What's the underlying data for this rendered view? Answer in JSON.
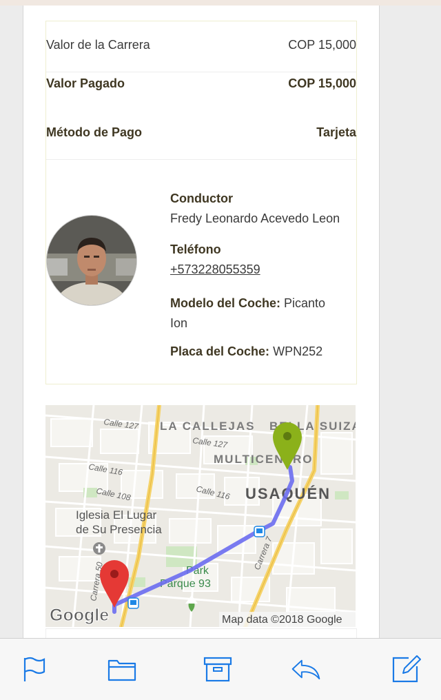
{
  "receipt": {
    "fare_label": "Valor de la Carrera",
    "fare_value": "COP 15,000",
    "paid_label": "Valor Pagado",
    "paid_value": "COP 15,000",
    "method_label": "Método de Pago",
    "method_value": "Tarjeta"
  },
  "driver": {
    "avatar_icon": "driver-avatar",
    "driver_label": "Conductor",
    "driver_name": "Fredy Leonardo Acevedo Leon",
    "phone_label": "Teléfono",
    "phone": "+573228055359",
    "model_label": "Modelo del Coche:",
    "model_value_line1": "Picanto",
    "model_value_line2": "Ion",
    "plate_label": "Placa del Coche:",
    "plate_value": "WPN252"
  },
  "map": {
    "labels": {
      "calle127a": "Calle 127",
      "calle127b": "Calle 127",
      "calle116a": "Calle 116",
      "calle116b": "Calle 116",
      "calle108": "Calle 108",
      "callejas": "LA CALLEJAS",
      "bella_suiza": "BELLA SUIZA",
      "multicentro": "MULTICENTRO",
      "usaquen": "USAQUÉN",
      "iglesia1": "Iglesia El Lugar",
      "iglesia2": "de Su Presencia",
      "park": "Park",
      "parque93": "Parque 93",
      "carrera7": "Carrera 7",
      "carrera50": "Carrera 50"
    },
    "google_logo": "Google",
    "attribution": "Map data ©2018 Google",
    "colors": {
      "route": "#6b6df0",
      "origin_pin": "#e53935",
      "destination_pin": "#8bb11a",
      "main_road": "#f5d36b"
    }
  },
  "toolbar": {
    "flag_icon": "flag-icon",
    "folder_icon": "folder-icon",
    "archive_icon": "archive-icon",
    "reply_icon": "reply-icon",
    "compose_icon": "compose-icon",
    "accent": "#1a7ae6"
  }
}
